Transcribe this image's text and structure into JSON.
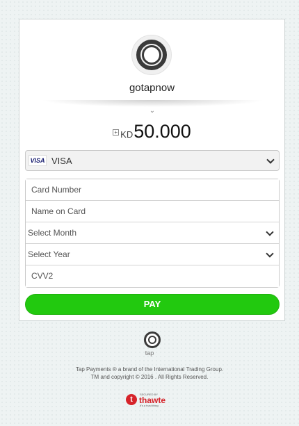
{
  "merchant": {
    "name": "gotapnow"
  },
  "amount": {
    "currency": "KD",
    "value": "50.000",
    "expand_icon": "plus-box-icon"
  },
  "card_type": {
    "selected": "VISA",
    "logo_text": "VISA"
  },
  "form": {
    "card_number_placeholder": "Card Number",
    "name_placeholder": "Name on Card",
    "month_select": "Select Month",
    "year_select": "Select Year",
    "cvv_placeholder": "CVV2"
  },
  "pay_button": {
    "label": "PAY",
    "color": "#22c90f"
  },
  "footer": {
    "tap_label": "tap",
    "line1": "Tap Payments ® a brand of the International Trading Group.",
    "line2": "TM and copyright © 2016 . All Rights Reserved."
  },
  "thawte": {
    "secured": "SECURED BY",
    "brand": "thawte",
    "tagline": "it's a trust thing"
  }
}
